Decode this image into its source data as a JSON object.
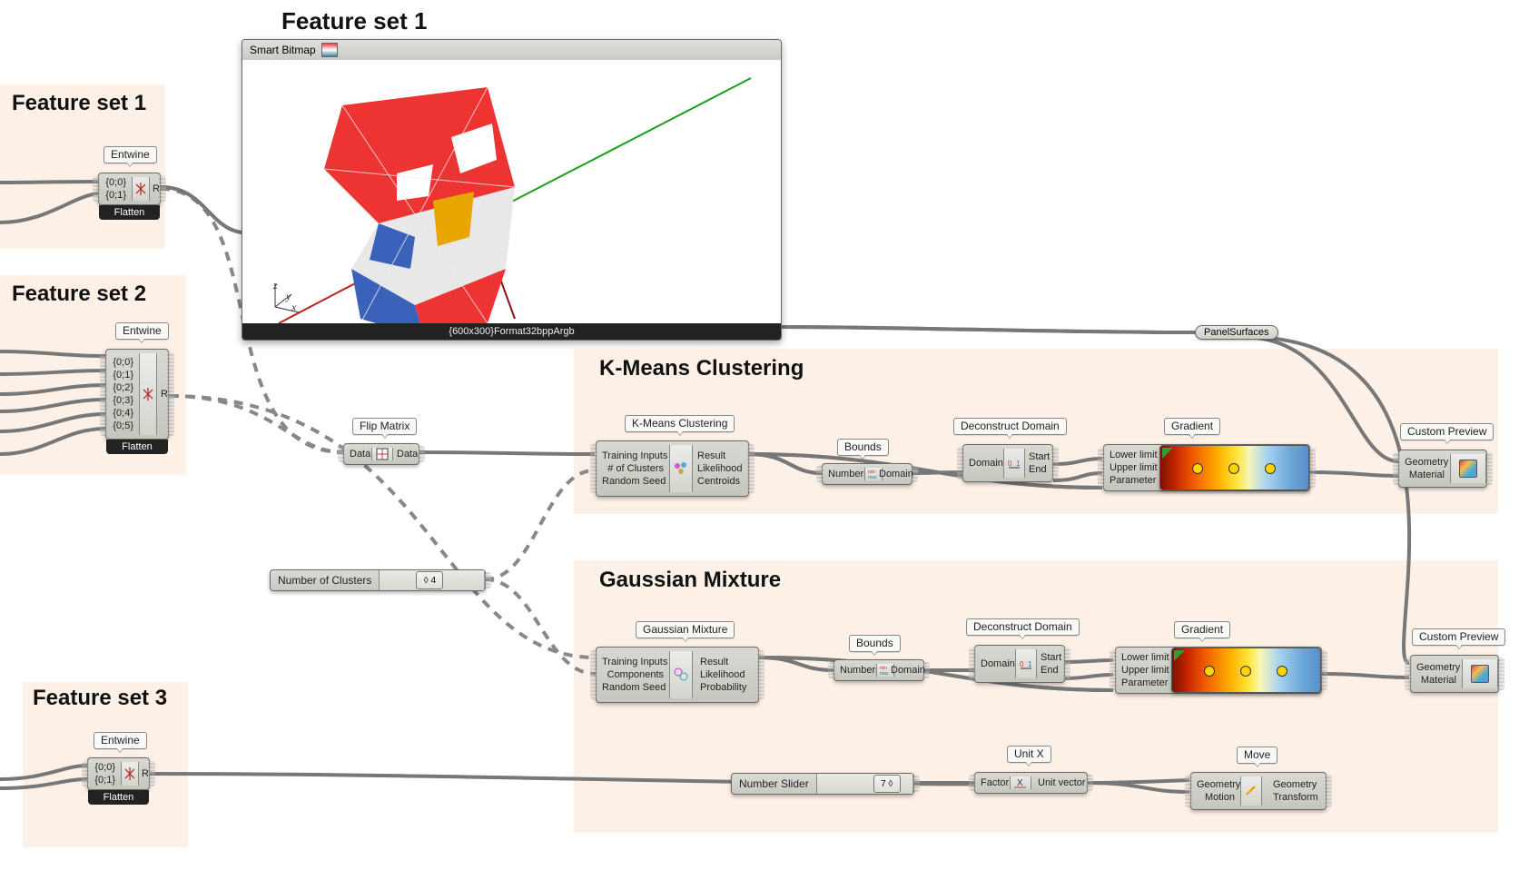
{
  "titles": {
    "fs1_top": "Feature set 1",
    "fs1": "Feature set 1",
    "fs2": "Feature set 2",
    "fs3": "Feature set 3",
    "kmeans": "K-Means Clustering",
    "gmm": "Gaussian Mixture"
  },
  "labels": {
    "entwine": "Entwine",
    "flatten": "Flatten",
    "flip": "Flip Matrix",
    "kmeans": "K-Means Clustering",
    "gmm": "Gaussian Mixture",
    "bounds": "Bounds",
    "decon": "Deconstruct Domain",
    "gradient": "Gradient",
    "custom_prev": "Custom Preview",
    "numclusters": "Number of Clusters",
    "unitx": "Unit X",
    "move": "Move",
    "numberslider": "Number Slider",
    "panelsurf": "PanelSurfaces"
  },
  "entwine1": [
    "{0;0}",
    "{0;1}"
  ],
  "entwine2": [
    "{0;0}",
    "{0;1}",
    "{0;2}",
    "{0;3}",
    "{0;4}",
    "{0;5}"
  ],
  "entwine3": [
    "{0;0}",
    "{0;1}"
  ],
  "entwine_out": "R",
  "flip": {
    "in": "Data",
    "out": "Data"
  },
  "kmeans_inputs": [
    "Training Inputs",
    "# of Clusters",
    "Random Seed"
  ],
  "kmeans_outputs": [
    "Result",
    "Likelihood",
    "Centroids"
  ],
  "gmm_inputs": [
    "Training Inputs",
    "Components",
    "Random Seed"
  ],
  "gmm_outputs": [
    "Result",
    "Likelihood",
    "Probability"
  ],
  "bounds": {
    "in": "Numbers",
    "out": "Domain"
  },
  "decon": {
    "in": "Domain",
    "out": [
      "Start",
      "End"
    ]
  },
  "gradient_inputs": [
    "Lower limit",
    "Upper limit",
    "Parameter"
  ],
  "preview": {
    "in": [
      "Geometry",
      "Material"
    ]
  },
  "unitx": {
    "in": "Factor",
    "out": "Unit vector"
  },
  "move": {
    "in": [
      "Geometry",
      "Motion"
    ],
    "out": [
      "Geometry",
      "Transform"
    ]
  },
  "slider1": {
    "value": "◊ 4"
  },
  "slider2": {
    "value": "7 ◊"
  },
  "bitmap": {
    "title": "Smart Bitmap",
    "footer": "{600x300}Format32bppArgb"
  },
  "axes": {
    "z": "z",
    "y": "y",
    "x": "x"
  }
}
